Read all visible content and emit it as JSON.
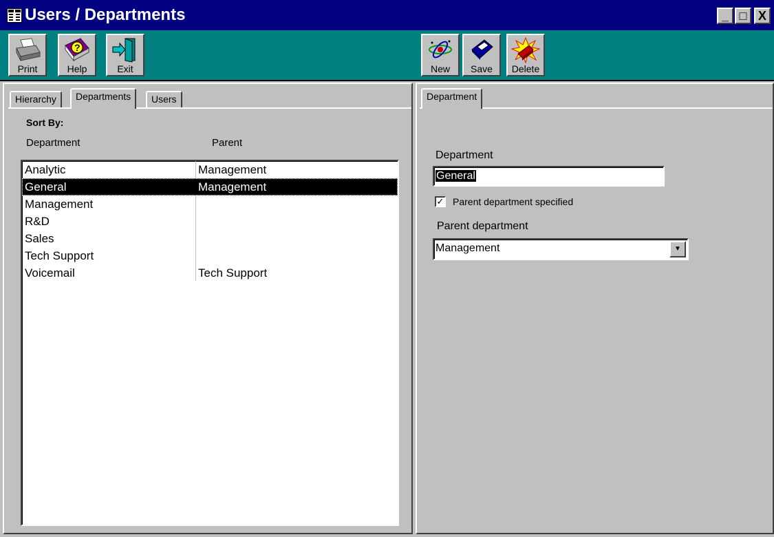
{
  "window": {
    "title": "Users / Departments",
    "min_glyph": "_",
    "max_glyph": "□",
    "close_glyph": "X"
  },
  "toolbar_left": [
    {
      "label": "Print",
      "icon": "printer-icon"
    },
    {
      "label": "Help",
      "icon": "help-book-icon"
    },
    {
      "label": "Exit",
      "icon": "exit-door-icon"
    }
  ],
  "toolbar_right": [
    {
      "label": "New",
      "icon": "new-atom-icon"
    },
    {
      "label": "Save",
      "icon": "floppy-disk-icon"
    },
    {
      "label": "Delete",
      "icon": "delete-explosion-icon"
    }
  ],
  "left_panel": {
    "tabs": [
      "Hierarchy",
      "Departments",
      "Users"
    ],
    "active_tab": "Departments",
    "sort_by_label": "Sort By:",
    "col_department": "Department",
    "col_parent": "Parent",
    "rows": [
      {
        "department": "Analytic",
        "parent": "Management",
        "selected": false
      },
      {
        "department": "General",
        "parent": "Management",
        "selected": true
      },
      {
        "department": "Management",
        "parent": "",
        "selected": false
      },
      {
        "department": "R&D",
        "parent": "",
        "selected": false
      },
      {
        "department": "Sales",
        "parent": "",
        "selected": false
      },
      {
        "department": "Tech Support",
        "parent": "",
        "selected": false
      },
      {
        "department": "Voicemail",
        "parent": "Tech Support",
        "selected": false
      }
    ]
  },
  "right_panel": {
    "tab": "Department",
    "department_label": "Department",
    "department_value": "General",
    "checkbox_label": "Parent department specified",
    "checkbox_checked": true,
    "parent_label": "Parent department",
    "parent_value": "Management"
  },
  "colors": {
    "titlebar": "#000080",
    "toolbar": "#008080",
    "face": "#c0c0c0",
    "selection": "#000000"
  }
}
